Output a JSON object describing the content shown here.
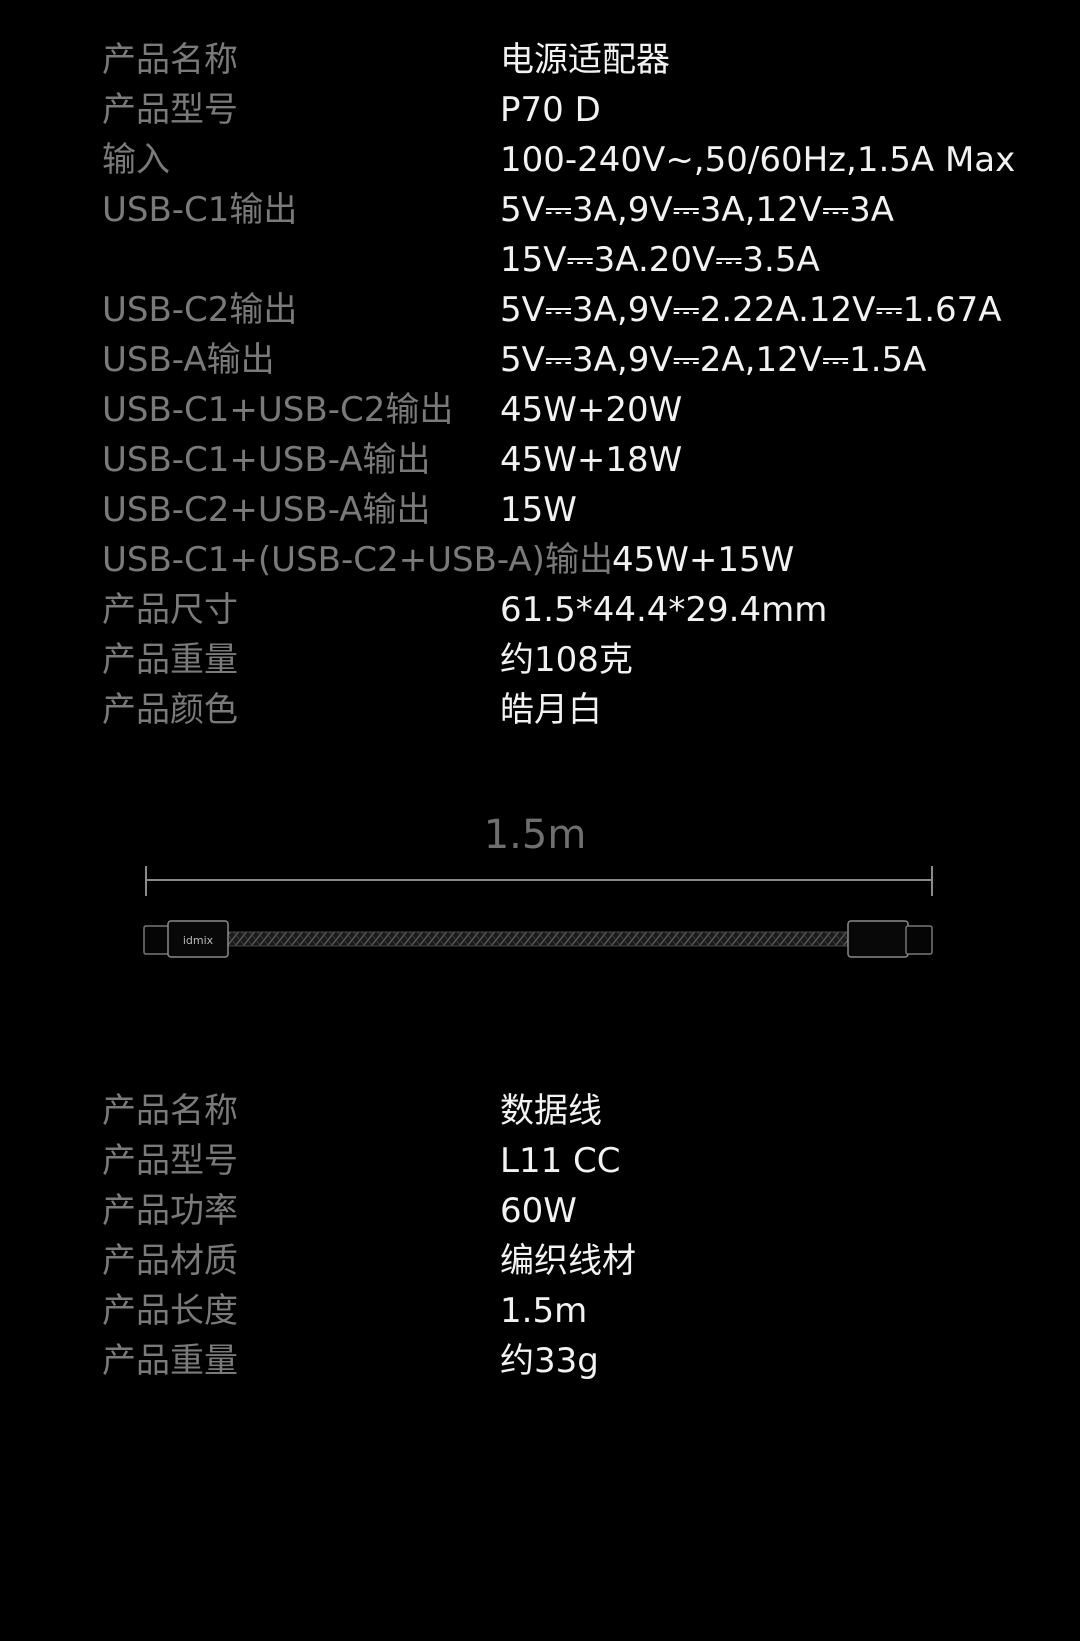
{
  "adapter": {
    "rows": [
      {
        "label": "产品名称",
        "value": "电源适配器"
      },
      {
        "label": "产品型号",
        "value": "P70 D"
      },
      {
        "label": "输入",
        "value": "100-240V~,50/60Hz,1.5A Max"
      },
      {
        "label": "USB-C1输出",
        "value": "5V⎓3A,9V⎓3A,12V⎓3A"
      },
      {
        "label": "",
        "value": "15V⎓3A.20V⎓3.5A"
      },
      {
        "label": "USB-C2输出",
        "value": "5V⎓3A,9V⎓2.22A.12V⎓1.67A"
      },
      {
        "label": "USB-A输出",
        "value": "5V⎓3A,9V⎓2A,12V⎓1.5A"
      },
      {
        "label": "USB-C1+USB-C2输出",
        "value": "45W+20W"
      },
      {
        "label": "USB-C1+USB-A输出",
        "value": "45W+18W"
      },
      {
        "label": "USB-C2+USB-A输出",
        "value": "15W"
      },
      {
        "label": "USB-C1+(USB-C2+USB-A)输出",
        "value": "45W+15W"
      },
      {
        "label": "产品尺寸",
        "value": "61.5*44.4*29.4mm"
      },
      {
        "label": "产品重量",
        "value": "约108克"
      },
      {
        "label": "产品颜色",
        "value": "皓月白"
      }
    ]
  },
  "cable_diagram": {
    "length_label": "1.5m",
    "brand_mark": "idmix"
  },
  "cable": {
    "rows": [
      {
        "label": "产品名称",
        "value": "数据线"
      },
      {
        "label": "产品型号",
        "value": "L11 CC"
      },
      {
        "label": "产品功率",
        "value": "60W"
      },
      {
        "label": "产品材质",
        "value": "编织线材"
      },
      {
        "label": "产品长度",
        "value": "1.5m"
      },
      {
        "label": "产品重量",
        "value": "约33g"
      }
    ]
  },
  "colors": {
    "background": "#000000",
    "label": "#7a7a7a",
    "value": "#f2f2f2"
  }
}
